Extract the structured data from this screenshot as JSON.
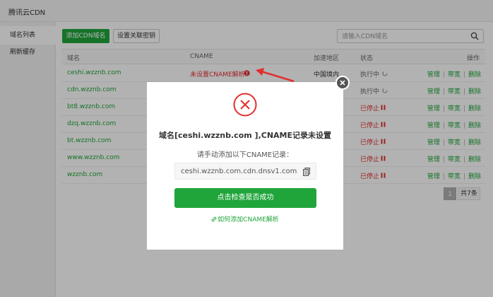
{
  "window": {
    "title": "腾讯云CDN"
  },
  "sidebar": {
    "items": [
      {
        "label": "域名列表"
      },
      {
        "label": "刷新缓存"
      }
    ]
  },
  "toolbar": {
    "add_label": "添加CDN域名",
    "key_label": "设置关联密钥",
    "search_placeholder": "请输入CDN域名"
  },
  "table": {
    "headers": {
      "domain": "域名",
      "cname": "CNAME",
      "region": "加速地区",
      "status": "状态",
      "ops": "操作"
    },
    "op_labels": {
      "manage": "管理",
      "bandwidth": "带宽",
      "delete": "删除"
    },
    "rows": [
      {
        "domain": "ceshi.wzznb.com",
        "cname": "未设置CNAME解析",
        "region": "中国境内",
        "status": "执行中"
      },
      {
        "domain": "cdn.wzznb.com",
        "cname": "",
        "region": "",
        "status": "执行中"
      },
      {
        "domain": "bt8.wzznb.com",
        "cname": "",
        "region": "",
        "status": "已停止"
      },
      {
        "domain": "dzq.wzznb.com",
        "cname": "",
        "region": "",
        "status": "已停止"
      },
      {
        "domain": "bt.wzznb.com",
        "cname": "",
        "region": "",
        "status": "已停止"
      },
      {
        "domain": "www.wzznb.com",
        "cname": "",
        "region": "",
        "status": "已停止"
      },
      {
        "domain": "wzznb.com",
        "cname": "",
        "region": "",
        "status": "已停止"
      }
    ]
  },
  "pagination": {
    "page": "1",
    "total": "共7条"
  },
  "modal": {
    "title": "域名[ceshi.wzznb.com ],CNAME记录未设置",
    "subtitle": "请手动添加以下CNAME记录：",
    "cname_value": "ceshi.wzznb.com.cdn.dnsv1.com",
    "check_label": "点击检查是否成功",
    "help_label": "如何添加CNAME解析"
  },
  "colors": {
    "accent": "#20a53a",
    "error": "#e32e2e"
  }
}
